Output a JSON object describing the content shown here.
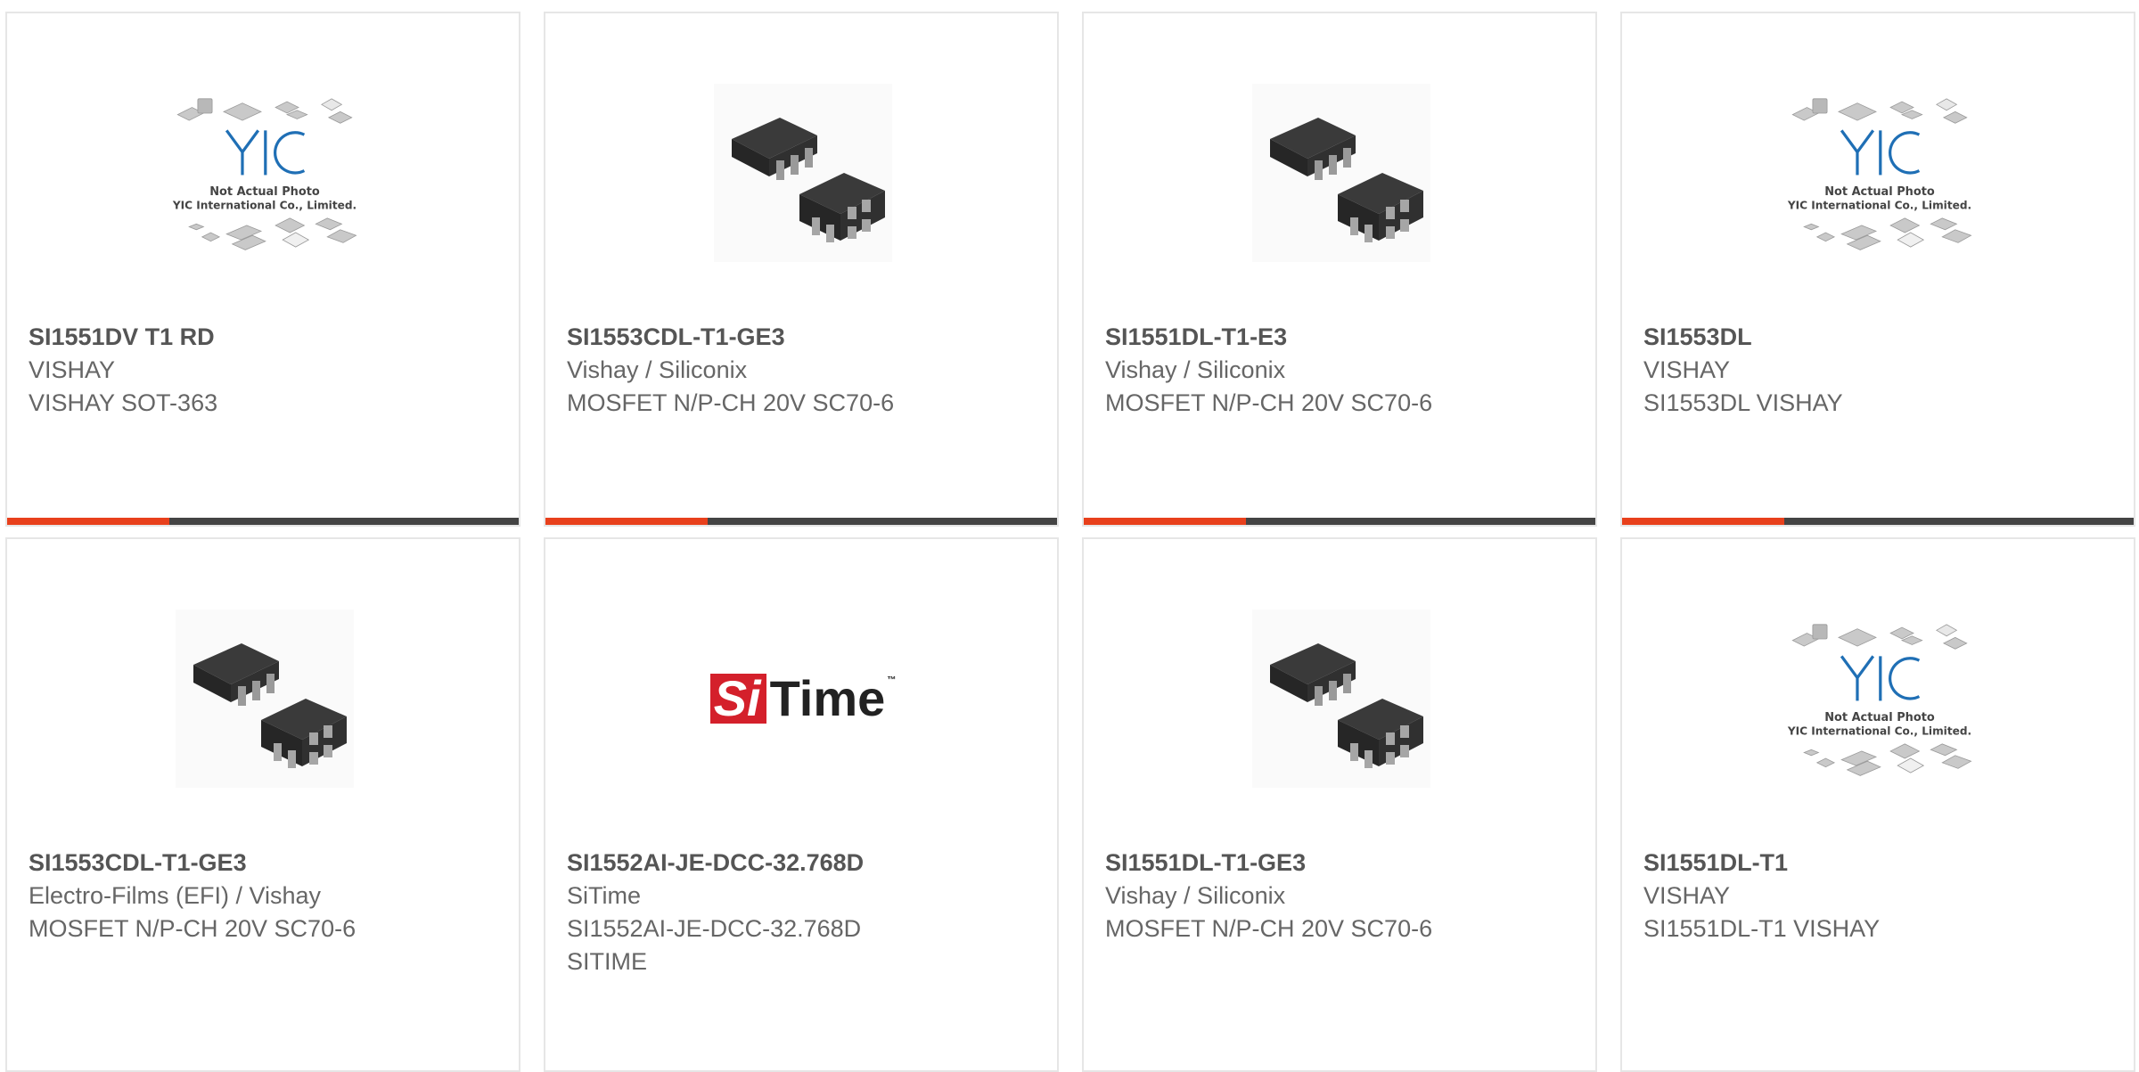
{
  "cards": [
    {
      "part_number": "SI1551DV T1 RD",
      "manufacturer": "VISHAY",
      "description": "VISHAY SOT-363",
      "description2": "",
      "image": "yic-placeholder"
    },
    {
      "part_number": "SI1553CDL-T1-GE3",
      "manufacturer": "Vishay / Siliconix",
      "description": "MOSFET N/P-CH 20V SC70-6",
      "description2": "",
      "image": "sc70-chip-photo"
    },
    {
      "part_number": "SI1551DL-T1-E3",
      "manufacturer": "Vishay / Siliconix",
      "description": "MOSFET N/P-CH 20V SC70-6",
      "description2": "",
      "image": "sc70-chip-photo"
    },
    {
      "part_number": "SI1553DL",
      "manufacturer": "VISHAY",
      "description": "SI1553DL VISHAY",
      "description2": "",
      "image": "yic-placeholder"
    },
    {
      "part_number": "SI1553CDL-T1-GE3",
      "manufacturer": "Electro-Films (EFI) / Vishay",
      "description": "MOSFET N/P-CH 20V SC70-6",
      "description2": "",
      "image": "sc70-chip-photo"
    },
    {
      "part_number": "SI1552AI-JE-DCC-32.768D",
      "manufacturer": "SiTime",
      "description": "SI1552AI-JE-DCC-32.768D",
      "description2": "SITIME",
      "image": "sitime-logo"
    },
    {
      "part_number": "SI1551DL-T1-GE3",
      "manufacturer": "Vishay / Siliconix",
      "description": "MOSFET N/P-CH 20V SC70-6",
      "description2": "",
      "image": "sc70-chip-photo"
    },
    {
      "part_number": "SI1551DL-T1",
      "manufacturer": "VISHAY",
      "description": "SI1551DL-T1 VISHAY",
      "description2": "",
      "image": "yic-placeholder"
    }
  ],
  "placeholder": {
    "logo": "YIC",
    "line1": "Not Actual Photo",
    "line2": "YIC International Co., Limited."
  },
  "sitime_logo": {
    "si": "Si",
    "time": "Time",
    "tm": "™"
  },
  "colors": {
    "accent": "#e8401c",
    "bar": "#444444",
    "border": "#e6e6e6",
    "yic_blue": "#1f6fb5",
    "sitime_red": "#d4202b"
  }
}
